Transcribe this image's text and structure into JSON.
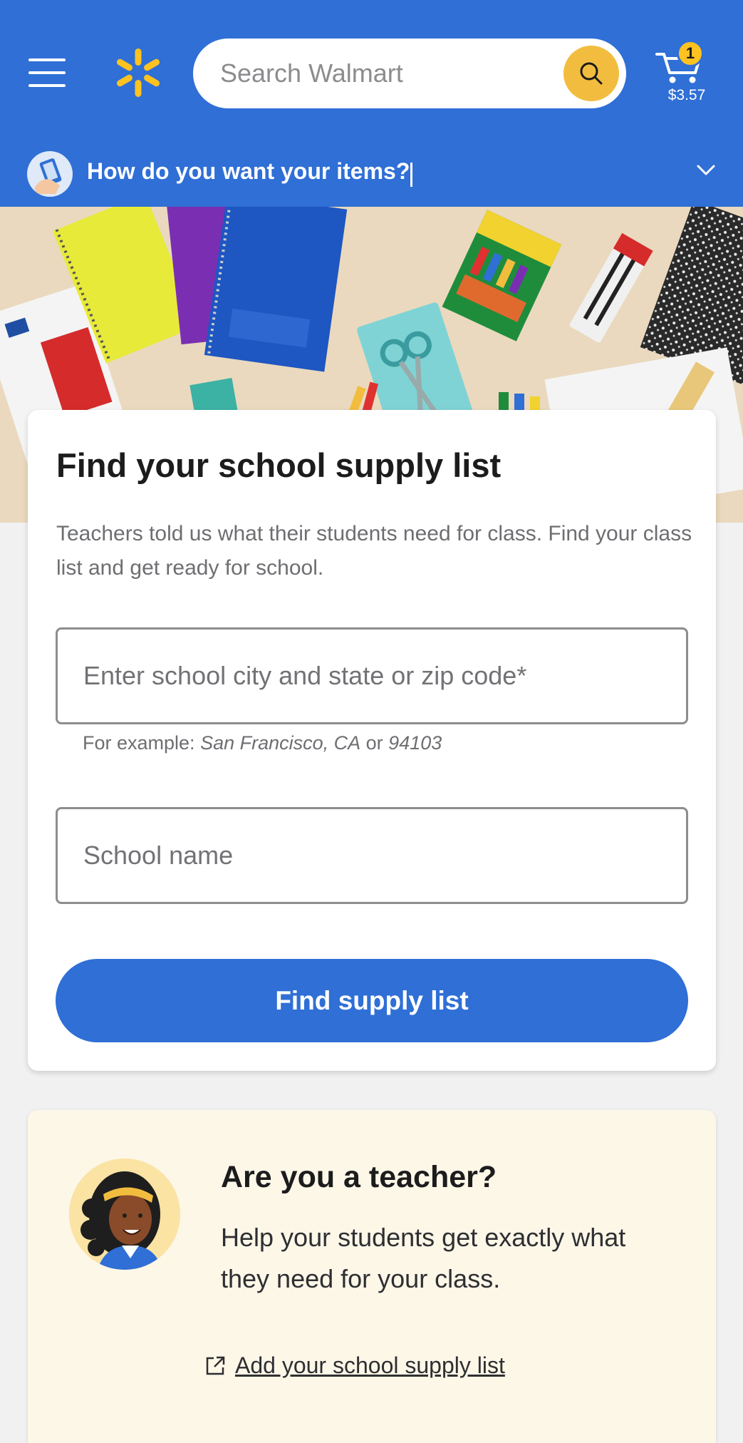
{
  "header": {
    "search_placeholder": "Search Walmart",
    "cart_count": "1",
    "cart_total": "$3.57",
    "delivery_prompt": "How do you want your items?",
    "brand_color": "#2f6fd6",
    "accent_color": "#f2bd3e"
  },
  "supply_card": {
    "title": "Find your school supply list",
    "description": "Teachers told us what their students need for class. Find your class list and get ready for school.",
    "city_placeholder": "Enter school city and state or zip code*",
    "hint_prefix": "For example: ",
    "hint_city": "San Francisco, CA",
    "hint_or": " or ",
    "hint_zip": "94103",
    "school_placeholder": "School name",
    "button_label": "Find supply list"
  },
  "teacher_card": {
    "title": "Are you a teacher?",
    "description": "Help your students get exactly what they need for your class.",
    "link_label": "Add your school supply list"
  },
  "icons": [
    "menu-icon",
    "walmart-spark-logo",
    "search-icon",
    "cart-icon",
    "delivery-icon",
    "chevron-down-icon",
    "external-link-icon",
    "teacher-avatar"
  ]
}
